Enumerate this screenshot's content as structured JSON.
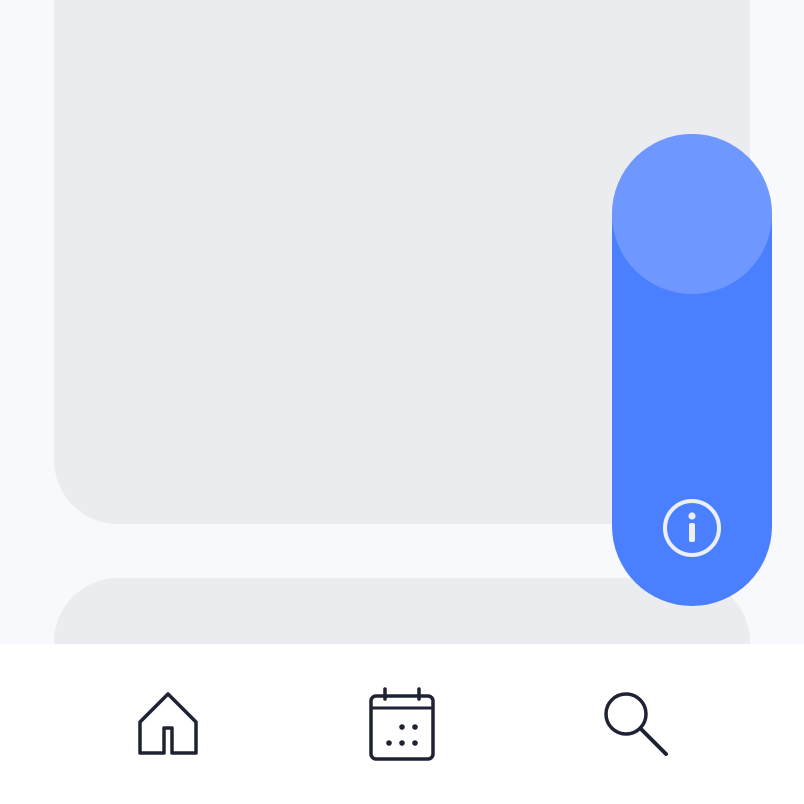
{
  "theme": {
    "background": "#F8F9FD",
    "card": "#EBECF0",
    "toggle_track": "#4A80FF",
    "toggle_knob": "#6E98FF",
    "info_icon_color": "#EDEFF7",
    "nav_background": "#FFFFFF",
    "nav_icon_color": "#1E2233"
  },
  "toggle": {
    "icon": "info-icon",
    "state": "on"
  },
  "bottom_nav": {
    "items": [
      {
        "icon": "home-icon"
      },
      {
        "icon": "calendar-icon"
      },
      {
        "icon": "search-icon"
      }
    ]
  }
}
